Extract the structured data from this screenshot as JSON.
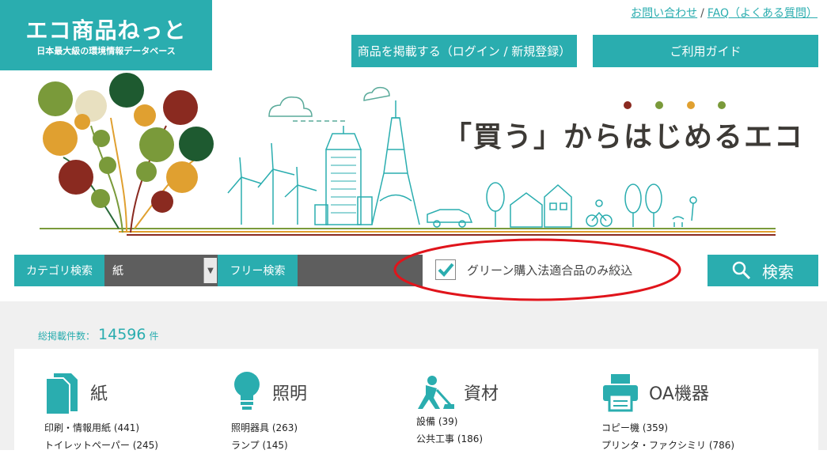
{
  "logo": {
    "title": "エコ商品ねっと",
    "subtitle": "日本最大級の環境情報データベース"
  },
  "top_links": {
    "contact": "お問い合わせ",
    "separator": "/",
    "faq": "FAQ（よくある質問）"
  },
  "top_buttons": {
    "login": "商品を掲載する（ログイン / 新規登録）",
    "guide": "ご利用ガイド"
  },
  "banner": {
    "headline": "「買う」からはじめるエコ"
  },
  "search": {
    "category_label": "カテゴリ検索",
    "category_value": "紙",
    "free_label": "フリー検索",
    "free_value": "",
    "green_checked": true,
    "green_label": "グリーン購入法適合品のみ絞込",
    "button_label": "検索"
  },
  "total": {
    "label": "総掲載件数：",
    "count": "14596",
    "unit": "件"
  },
  "categories": [
    {
      "name": "紙",
      "icon": "paper-icon",
      "items": [
        "印刷・情報用紙 (441)",
        "トイレットペーパー (245)"
      ]
    },
    {
      "name": "照明",
      "icon": "light-bulb-icon",
      "items": [
        "照明器具 (263)",
        "ランプ (145)"
      ]
    },
    {
      "name": "資材",
      "icon": "construction-icon",
      "items": [
        "設備 (39)",
        "公共工事 (186)"
      ]
    },
    {
      "name": "OA機器",
      "icon": "printer-icon",
      "items": [
        "コピー機 (359)",
        "プリンタ・ファクシミリ (786)"
      ]
    }
  ],
  "colors": {
    "accent": "#2aadaf",
    "dark_gray": "#5e5e5e",
    "highlight": "#e0141b",
    "panel_bg": "#f0f0f0"
  }
}
